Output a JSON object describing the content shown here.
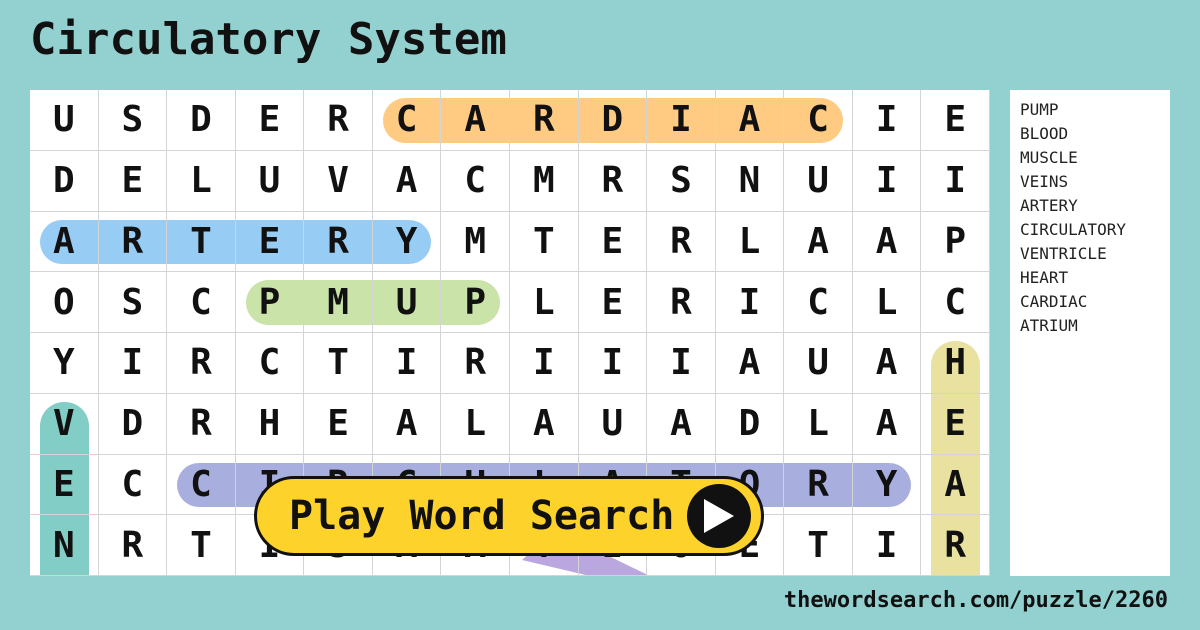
{
  "title": "Circulatory System",
  "grid": [
    "USDERCARDIACIE",
    "DELUVACMRSNUII",
    "ARTERYMTERLAAP",
    "OSCPMUPLERICLC",
    "YIRCTIRIIIAUAH",
    "VDRHEALAUADLAE",
    "ECCIRCULATORYA",
    "NRTISAATIOETIR"
  ],
  "highlights": [
    {
      "word": "CARDIAC",
      "row": 0,
      "col": 5,
      "len": 7,
      "dir": "h",
      "color": "#ffc574"
    },
    {
      "word": "ARTERY",
      "row": 2,
      "col": 0,
      "len": 6,
      "dir": "h",
      "color": "#8cc6f4"
    },
    {
      "word": "PUMP",
      "row": 3,
      "col": 3,
      "len": 4,
      "dir": "h",
      "color": "#c3e0a0"
    },
    {
      "word": "CIRCULATORY",
      "row": 6,
      "col": 2,
      "len": 11,
      "dir": "h",
      "color": "#9ea6dc"
    },
    {
      "word": "VEN",
      "row": 5,
      "col": 0,
      "len": 3,
      "dir": "v",
      "color": "#74c9c0"
    },
    {
      "word": "HEAR",
      "row": 4,
      "col": 13,
      "len": 4,
      "dir": "v",
      "color": "#e6de96"
    }
  ],
  "words": [
    "PUMP",
    "BLOOD",
    "MUSCLE",
    "VEINS",
    "ARTERY",
    "CIRCULATORY",
    "VENTRICLE",
    "HEART",
    "CARDIAC",
    "ATRIUM"
  ],
  "play_label": "Play Word Search",
  "play_icon": "play-icon",
  "url": "thewordsearch.com/puzzle/2260"
}
